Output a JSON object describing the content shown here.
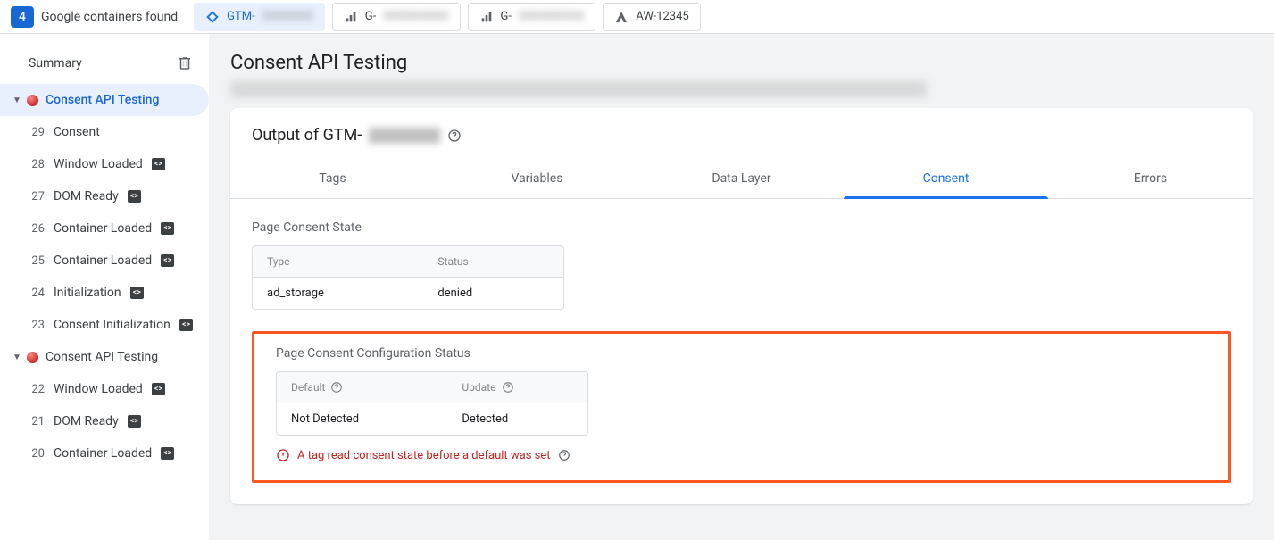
{
  "topbar": {
    "count": "4",
    "found_label": "Google containers found",
    "chips": [
      {
        "prefix": "GTM-",
        "rest": "XXXXXXX",
        "type": "gtm",
        "active": true
      },
      {
        "prefix": "G-",
        "rest": "XXXXXXXXX",
        "type": "ga",
        "active": false
      },
      {
        "prefix": "G-",
        "rest": "XXXXXXXXX",
        "type": "ga",
        "active": false
      },
      {
        "prefix": "AW-12345",
        "rest": "",
        "type": "ads",
        "active": false
      }
    ]
  },
  "sidebar": {
    "summary": "Summary",
    "groups": [
      {
        "label": "Consent API Testing",
        "active_event_idx": -1,
        "group_active": true,
        "events": [
          {
            "num": "29",
            "label": "Consent",
            "api": false
          },
          {
            "num": "28",
            "label": "Window Loaded",
            "api": true
          },
          {
            "num": "27",
            "label": "DOM Ready",
            "api": true
          },
          {
            "num": "26",
            "label": "Container Loaded",
            "api": true
          },
          {
            "num": "25",
            "label": "Container Loaded",
            "api": true
          },
          {
            "num": "24",
            "label": "Initialization",
            "api": true
          },
          {
            "num": "23",
            "label": "Consent Initialization",
            "api": true
          }
        ]
      },
      {
        "label": "Consent API Testing",
        "active_event_idx": -2,
        "group_active": false,
        "events": [
          {
            "num": "22",
            "label": "Window Loaded",
            "api": true
          },
          {
            "num": "21",
            "label": "DOM Ready",
            "api": true
          },
          {
            "num": "20",
            "label": "Container Loaded",
            "api": true
          }
        ]
      }
    ]
  },
  "main": {
    "title": "Consent API Testing",
    "output_prefix": "Output of GTM-",
    "tabs": [
      "Tags",
      "Variables",
      "Data Layer",
      "Consent",
      "Errors"
    ],
    "active_tab": 3,
    "consent_state": {
      "title": "Page Consent State",
      "head": [
        "Type",
        "Status"
      ],
      "rows": [
        [
          "ad_storage",
          "denied"
        ]
      ]
    },
    "config_status": {
      "title": "Page Consent Configuration Status",
      "head": [
        "Default",
        "Update"
      ],
      "rows": [
        [
          "Not Detected",
          "Detected"
        ]
      ],
      "warning": "A tag read consent state before a default was set"
    }
  }
}
